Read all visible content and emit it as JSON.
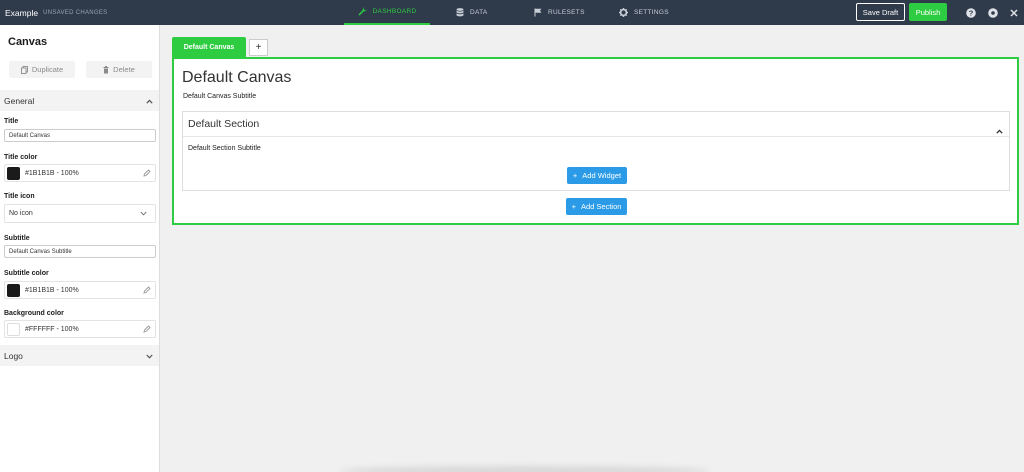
{
  "topbar": {
    "app_title": "Example",
    "unsaved": "UNSAVED CHANGES",
    "nav": {
      "dashboard": "DASHBOARD",
      "data": "DATA",
      "rulesets": "RULESETS",
      "settings": "SETTINGS"
    },
    "save_draft": "Save Draft",
    "publish": "Publish"
  },
  "sidebar": {
    "title": "Canvas",
    "duplicate": "Duplicate",
    "delete": "Delete",
    "general_label": "General",
    "fields": {
      "title_label": "Title",
      "title_value": "Default Canvas",
      "title_color_label": "Title color",
      "title_color_value": "#1B1B1B - 100%",
      "title_icon_label": "Title icon",
      "title_icon_value": "No icon",
      "subtitle_label": "Subtitle",
      "subtitle_value": "Default Canvas Subtitle",
      "subtitle_color_label": "Subtitle color",
      "subtitle_color_value": "#1B1B1B - 100%",
      "background_color_label": "Background color",
      "background_color_value": "#FFFFFF - 100%"
    },
    "logo_label": "Logo"
  },
  "main": {
    "tab_label": "Default Canvas",
    "add_tab": "+",
    "canvas_title": "Default Canvas",
    "canvas_subtitle": "Default Canvas Subtitle",
    "section_title": "Default Section",
    "section_subtitle": "Default Section Subtitle",
    "add_widget": "Add Widget",
    "add_section": "Add Section"
  },
  "colors": {
    "accent": "#2ecc40",
    "topbar_bg": "#2f3a4a",
    "button_blue": "#2b9be8",
    "title_color": "#1b1b1b",
    "background_color": "#ffffff"
  },
  "icons": {
    "dashboard": "wrench-icon",
    "data": "database-icon",
    "rulesets": "flag-icon",
    "settings": "gear-icon",
    "help": "help-icon",
    "account": "settings-circle-icon",
    "close": "close-icon",
    "duplicate": "copy-icon",
    "delete": "trash-icon",
    "edit": "pencil-icon",
    "collapse": "chevron-up-icon",
    "expand": "chevron-down-icon"
  }
}
